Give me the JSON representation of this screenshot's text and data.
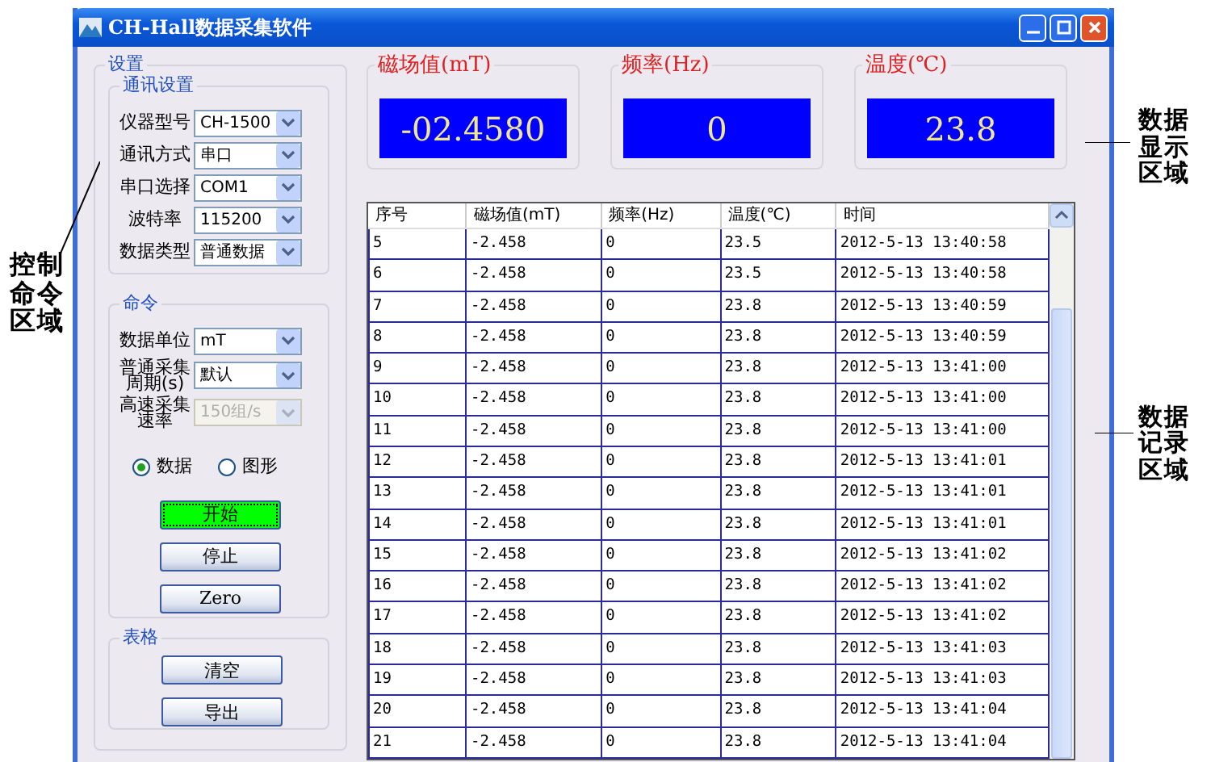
{
  "window": {
    "title": "CH-Hall数据采集软件"
  },
  "settings": {
    "title": "设置",
    "comm": {
      "title": "通讯设置",
      "fields": [
        {
          "label": [
            "仪器型号"
          ],
          "value": "CH-1500",
          "disabled": false
        },
        {
          "label": [
            "通讯方式"
          ],
          "value": "串口",
          "disabled": false
        },
        {
          "label": [
            "串口选择"
          ],
          "value": "COM1",
          "disabled": false
        },
        {
          "label": [
            "波特率"
          ],
          "value": "115200",
          "disabled": false
        },
        {
          "label": [
            "数据类型"
          ],
          "value": "普通数据",
          "disabled": false
        }
      ]
    },
    "command": {
      "title": "命令",
      "fields": [
        {
          "label": [
            "数据单位"
          ],
          "value": "mT",
          "disabled": false
        },
        {
          "label": [
            "普通采集",
            "周期(s)"
          ],
          "value": "默认",
          "disabled": false
        },
        {
          "label": [
            "高速采集",
            "速率"
          ],
          "value": "150组/s",
          "disabled": true
        }
      ],
      "modes": [
        {
          "label": "数据",
          "selected": true
        },
        {
          "label": "图形",
          "selected": false
        }
      ],
      "buttons": [
        {
          "label": "开始",
          "kind": "active"
        },
        {
          "label": "停止",
          "kind": "normal"
        },
        {
          "label": "Zero",
          "kind": "normal"
        }
      ]
    },
    "table_group": {
      "title": "表格",
      "buttons": [
        "清空",
        "导出"
      ]
    }
  },
  "displays": [
    {
      "title": "磁场值(mT)",
      "value": "-02.4580"
    },
    {
      "title": "频率(Hz)",
      "value": "0"
    },
    {
      "title": "温度(℃)",
      "value": "23.8"
    }
  ],
  "table": {
    "columns": [
      "序号",
      "磁场值(mT)",
      "频率(Hz)",
      "温度(℃)",
      "时间"
    ],
    "rows": [
      [
        "5",
        "-2.458",
        "0",
        "23.5",
        "2012-5-13 13:40:58"
      ],
      [
        "6",
        "-2.458",
        "0",
        "23.5",
        "2012-5-13 13:40:58"
      ],
      [
        "7",
        "-2.458",
        "0",
        "23.8",
        "2012-5-13 13:40:59"
      ],
      [
        "8",
        "-2.458",
        "0",
        "23.8",
        "2012-5-13 13:40:59"
      ],
      [
        "9",
        "-2.458",
        "0",
        "23.8",
        "2012-5-13 13:41:00"
      ],
      [
        "10",
        "-2.458",
        "0",
        "23.8",
        "2012-5-13 13:41:00"
      ],
      [
        "11",
        "-2.458",
        "0",
        "23.8",
        "2012-5-13 13:41:00"
      ],
      [
        "12",
        "-2.458",
        "0",
        "23.8",
        "2012-5-13 13:41:01"
      ],
      [
        "13",
        "-2.458",
        "0",
        "23.8",
        "2012-5-13 13:41:01"
      ],
      [
        "14",
        "-2.458",
        "0",
        "23.8",
        "2012-5-13 13:41:01"
      ],
      [
        "15",
        "-2.458",
        "0",
        "23.8",
        "2012-5-13 13:41:02"
      ],
      [
        "16",
        "-2.458",
        "0",
        "23.8",
        "2012-5-13 13:41:02"
      ],
      [
        "17",
        "-2.458",
        "0",
        "23.8",
        "2012-5-13 13:41:02"
      ],
      [
        "18",
        "-2.458",
        "0",
        "23.8",
        "2012-5-13 13:41:03"
      ],
      [
        "19",
        "-2.458",
        "0",
        "23.8",
        "2012-5-13 13:41:03"
      ],
      [
        "20",
        "-2.458",
        "0",
        "23.8",
        "2012-5-13 13:41:04"
      ],
      [
        "21",
        "-2.458",
        "0",
        "23.8",
        "2012-5-13 13:41:04"
      ]
    ]
  },
  "annotations": {
    "left": "控制命令区域",
    "right": [
      "数据显示区域",
      "数据记录区域"
    ]
  }
}
